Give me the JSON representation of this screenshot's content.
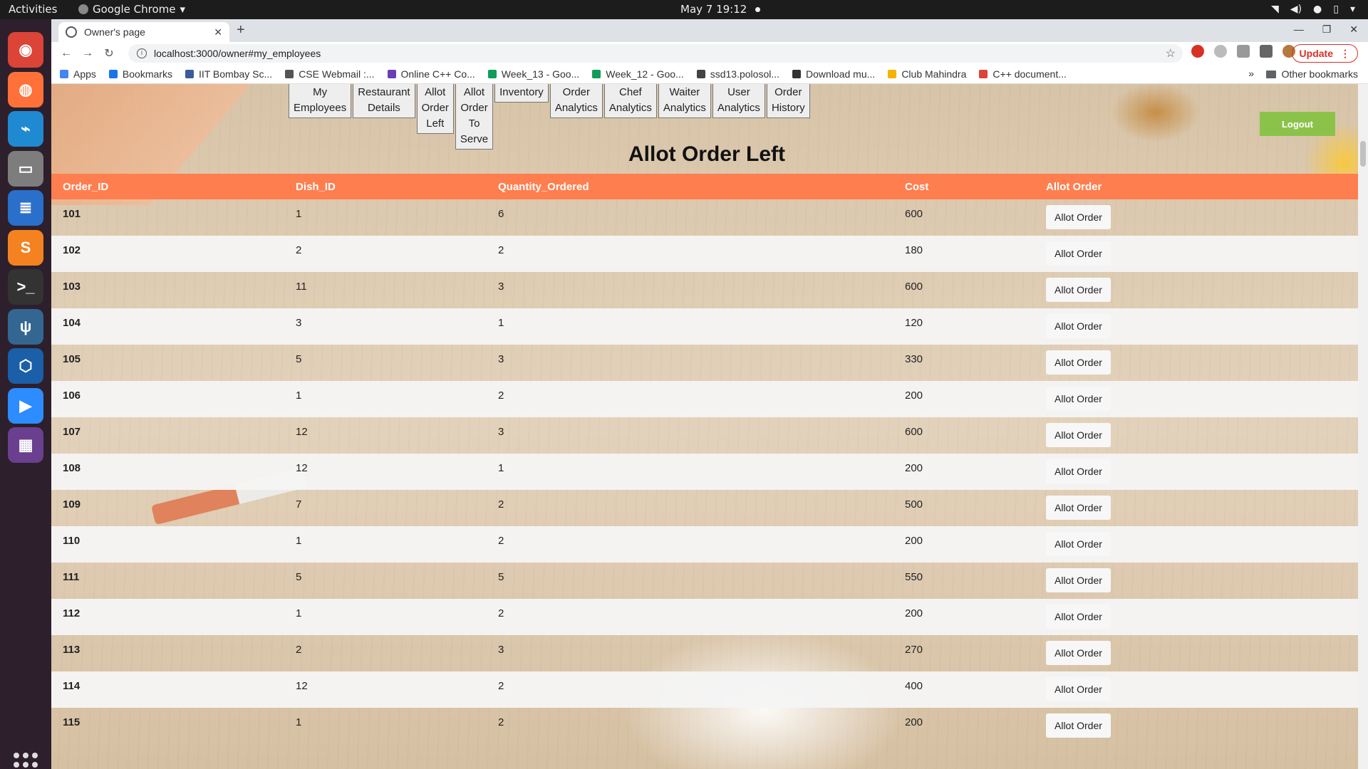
{
  "system_bar": {
    "activities": "Activities",
    "app_name": "Google Chrome",
    "clock": "May 7  19:12"
  },
  "browser": {
    "tab_title": "Owner's page",
    "url": "localhost:3000/owner#my_employees",
    "update_label": "Update",
    "bookmarks": [
      {
        "label": "Apps",
        "color": "#4285f4"
      },
      {
        "label": "Bookmarks",
        "color": "#1a73e8"
      },
      {
        "label": "IIT Bombay Sc...",
        "color": "#3a5ba0"
      },
      {
        "label": "CSE Webmail :...",
        "color": "#555555"
      },
      {
        "label": "Online C++ Co...",
        "color": "#6a3fb5"
      },
      {
        "label": "Week_13 - Goo...",
        "color": "#0f9d58"
      },
      {
        "label": "Week_12 - Goo...",
        "color": "#0f9d58"
      },
      {
        "label": "ssd13.polosol...",
        "color": "#444444"
      },
      {
        "label": "Download mu...",
        "color": "#333333"
      },
      {
        "label": "Club Mahindra",
        "color": "#f4b400"
      },
      {
        "label": "C++ document...",
        "color": "#db4437"
      }
    ],
    "other_bookmarks": "Other bookmarks"
  },
  "page": {
    "nav_tabs": [
      [
        "My",
        "Employees"
      ],
      [
        "Restaurant",
        "Details"
      ],
      [
        "Allot",
        "Order",
        "Left"
      ],
      [
        "Allot",
        "Order",
        "To",
        "Serve"
      ],
      [
        "Inventory"
      ],
      [
        "Order",
        "Analytics"
      ],
      [
        "Chef",
        "Analytics"
      ],
      [
        "Waiter",
        "Analytics"
      ],
      [
        "User",
        "Analytics"
      ],
      [
        "Order",
        "History"
      ]
    ],
    "logout_label": "Logout",
    "heading": "Allot Order Left",
    "table": {
      "headers": [
        "Order_ID",
        "Dish_ID",
        "Quantity_Ordered",
        "Cost",
        "Allot Order"
      ],
      "button_label": "Allot Order",
      "rows": [
        [
          "101",
          "1",
          "6",
          "600"
        ],
        [
          "102",
          "2",
          "2",
          "180"
        ],
        [
          "103",
          "11",
          "3",
          "600"
        ],
        [
          "104",
          "3",
          "1",
          "120"
        ],
        [
          "105",
          "5",
          "3",
          "330"
        ],
        [
          "106",
          "1",
          "2",
          "200"
        ],
        [
          "107",
          "12",
          "3",
          "600"
        ],
        [
          "108",
          "12",
          "1",
          "200"
        ],
        [
          "109",
          "7",
          "2",
          "500"
        ],
        [
          "110",
          "1",
          "2",
          "200"
        ],
        [
          "111",
          "5",
          "5",
          "550"
        ],
        [
          "112",
          "1",
          "2",
          "200"
        ],
        [
          "113",
          "2",
          "3",
          "270"
        ],
        [
          "114",
          "12",
          "2",
          "400"
        ],
        [
          "115",
          "1",
          "2",
          "200"
        ]
      ]
    },
    "colors": {
      "header_bg": "#ff7e4f",
      "logout_bg": "#8bc34a"
    }
  },
  "dock": {
    "apps": [
      {
        "icon": "chrome-icon",
        "color": "#db4437",
        "glyph": "◉"
      },
      {
        "icon": "firefox-icon",
        "color": "#ff7139",
        "glyph": "◍"
      },
      {
        "icon": "vscode-icon",
        "color": "#1f8ad2",
        "glyph": "⌁"
      },
      {
        "icon": "files-icon",
        "color": "#7d7d7d",
        "glyph": "▭"
      },
      {
        "icon": "writer-icon",
        "color": "#2a6fc9",
        "glyph": "≣"
      },
      {
        "icon": "sublime-icon",
        "color": "#f58220",
        "glyph": "S"
      },
      {
        "icon": "terminal-icon",
        "color": "#333333",
        "glyph": ">_"
      },
      {
        "icon": "postgres-icon",
        "color": "#336791",
        "glyph": "ψ"
      },
      {
        "icon": "virtualbox-icon",
        "color": "#1a5fa8",
        "glyph": "⬡"
      },
      {
        "icon": "zoom-icon",
        "color": "#2d8cff",
        "glyph": "▶"
      },
      {
        "icon": "video-editor-icon",
        "color": "#6a3f8f",
        "glyph": "▦"
      }
    ]
  }
}
